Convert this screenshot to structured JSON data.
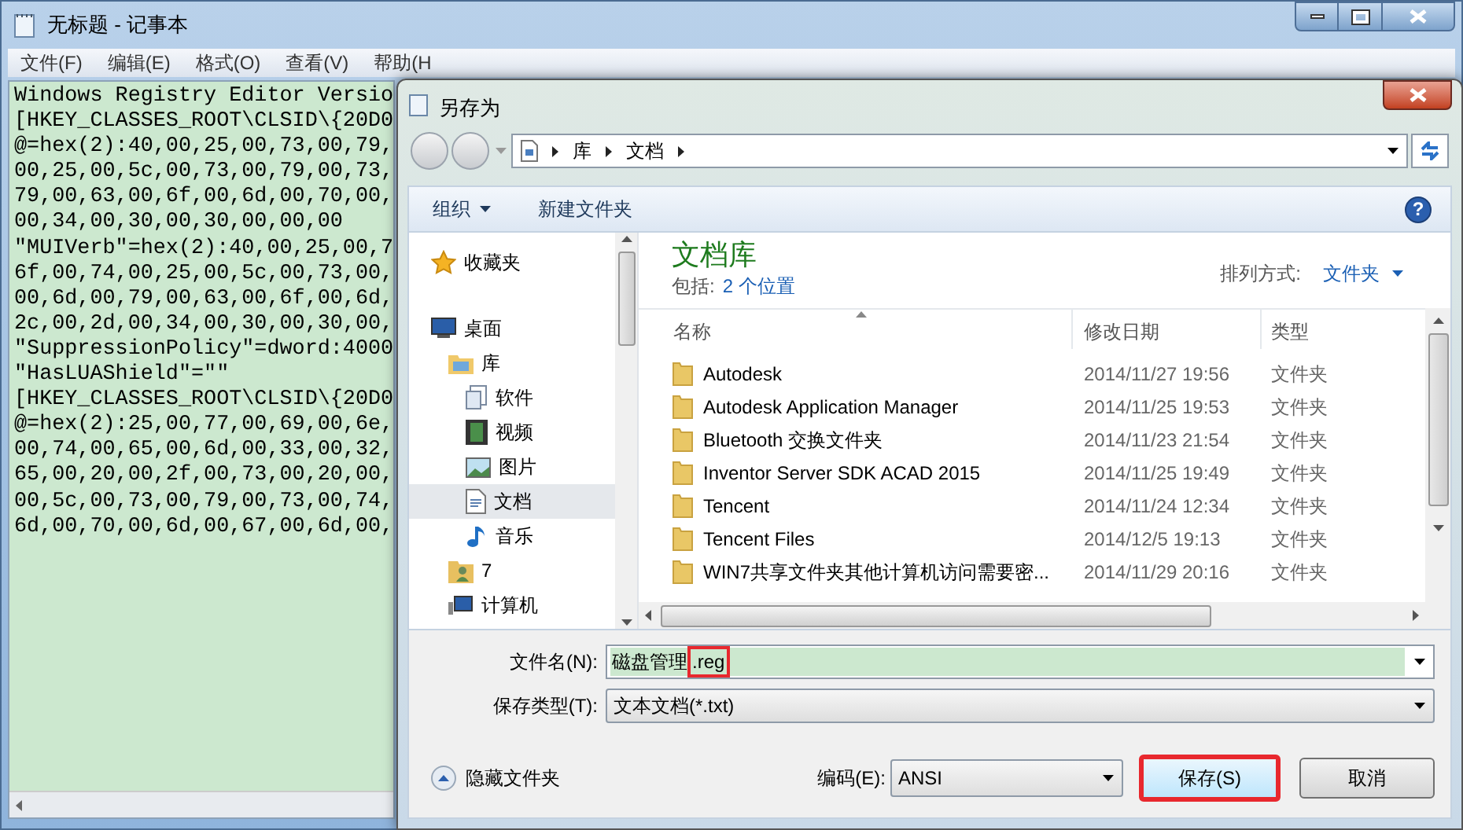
{
  "notepad": {
    "title": "无标题 - 记事本",
    "menu": [
      "文件(F)",
      "编辑(E)",
      "格式(O)",
      "查看(V)",
      "帮助(H"
    ],
    "lines": [
      "Windows Registry Editor Versio",
      "[HKEY_CLASSES_ROOT\\CLSID\\{20D0",
      "@=hex(2):40,00,25,00,73,00,79,",
      "00,25,00,5c,00,73,00,79,00,73,",
      "79,00,63,00,6f,00,6d,00,70,00,",
      "00,34,00,30,00,30,00,00,00",
      "\"MUIVerb\"=hex(2):40,00,25,00,7",
      "6f,00,74,00,25,00,5c,00,73,00,",
      "00,6d,00,79,00,63,00,6f,00,6d,",
      "2c,00,2d,00,34,00,30,00,30,00,",
      "\"SuppressionPolicy\"=dword:4000",
      "\"HasLUAShield\"=\"\"",
      "[HKEY_CLASSES_ROOT\\CLSID\\{20D0",
      "@=hex(2):25,00,77,00,69,00,6e,",
      "00,74,00,65,00,6d,00,33,00,32,",
      "65,00,20,00,2f,00,73,00,20,00,",
      "00,5c,00,73,00,79,00,73,00,74,",
      "6d,00,70,00,6d,00,67,00,6d,00,"
    ]
  },
  "dialog": {
    "title": "另存为",
    "breadcrumb": [
      "库",
      "文档"
    ],
    "toolbar": {
      "organize": "组织",
      "new_folder": "新建文件夹",
      "help": "?"
    },
    "nav": [
      {
        "label": "收藏夹",
        "kind": "favorites",
        "selected": false
      },
      {
        "label": "桌面",
        "kind": "desktop",
        "selected": false,
        "children": [
          {
            "label": "库",
            "kind": "library",
            "selected": false,
            "children": [
              {
                "label": "软件",
                "kind": "software",
                "selected": false
              },
              {
                "label": "视频",
                "kind": "video",
                "selected": false
              },
              {
                "label": "图片",
                "kind": "picture",
                "selected": false
              },
              {
                "label": "文档",
                "kind": "document",
                "selected": true
              },
              {
                "label": "音乐",
                "kind": "music",
                "selected": false
              }
            ]
          },
          {
            "label": "7",
            "kind": "user",
            "selected": false
          },
          {
            "label": "计算机",
            "kind": "computer",
            "selected": false
          }
        ]
      }
    ],
    "library": {
      "title": "文档库",
      "includes_label": "包括:",
      "includes_link": "2 个位置",
      "sort_label": "排列方式:",
      "sort_value": "文件夹"
    },
    "columns": [
      "名称",
      "修改日期",
      "类型"
    ],
    "rows": [
      {
        "name": "Autodesk",
        "date": "2014/11/27 19:56",
        "type": "文件夹"
      },
      {
        "name": "Autodesk Application Manager",
        "date": "2014/11/25 19:53",
        "type": "文件夹"
      },
      {
        "name": "Bluetooth 交换文件夹",
        "date": "2014/11/23 21:54",
        "type": "文件夹"
      },
      {
        "name": "Inventor Server SDK ACAD 2015",
        "date": "2014/11/25 19:49",
        "type": "文件夹"
      },
      {
        "name": "Tencent",
        "date": "2014/11/24 12:34",
        "type": "文件夹"
      },
      {
        "name": "Tencent Files",
        "date": "2014/12/5 19:13",
        "type": "文件夹"
      },
      {
        "name": "WIN7共享文件夹其他计算机访问需要密...",
        "date": "2014/11/29 20:16",
        "type": "文件夹"
      }
    ],
    "filename": {
      "label": "文件名(N):",
      "base": "磁盘管理",
      "extension": ".reg",
      "extension_highlighted": true
    },
    "filetype": {
      "label": "保存类型(T):",
      "value": "文本文档(*.txt)"
    },
    "hide_folders": "隐藏文件夹",
    "encoding": {
      "label": "编码(E):",
      "value": "ANSI"
    },
    "save": {
      "label": "保存(S)",
      "highlighted": true
    },
    "cancel": "取消"
  }
}
